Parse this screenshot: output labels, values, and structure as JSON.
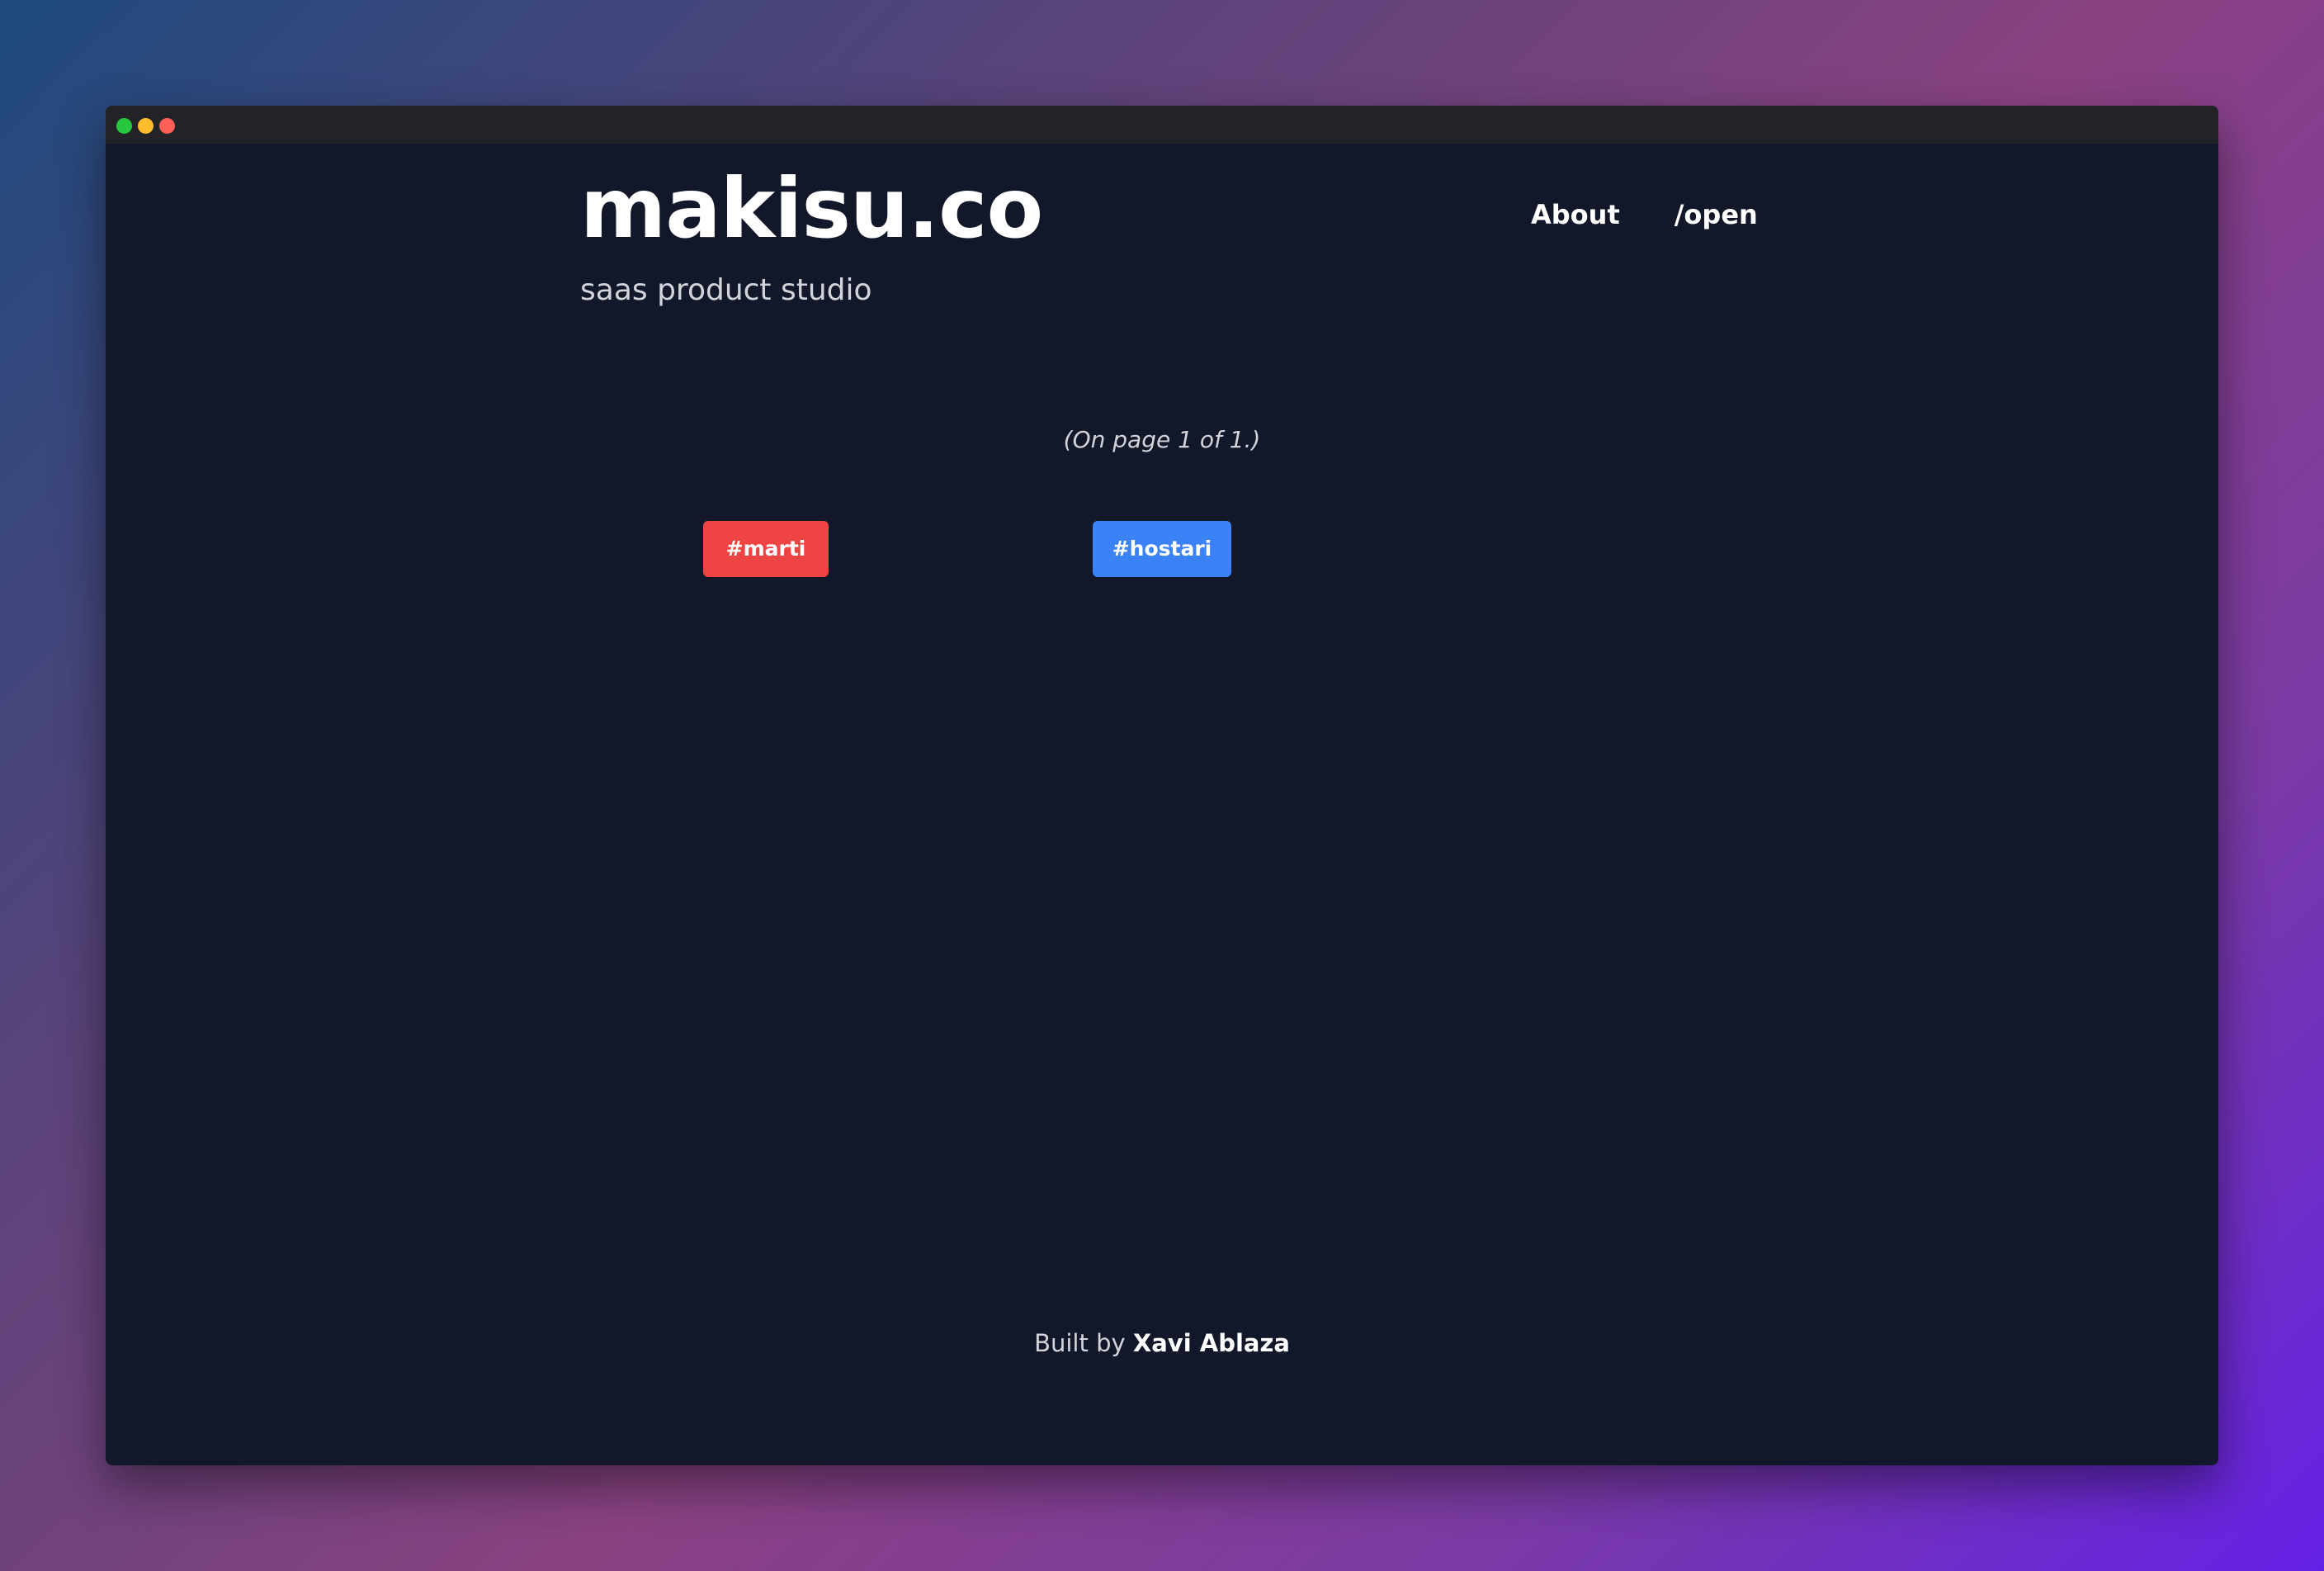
{
  "window": {
    "controls": [
      "green-dot",
      "yellow-dot",
      "red-dot"
    ]
  },
  "header": {
    "title": "makisu.co",
    "tagline": "saas product studio",
    "nav": [
      {
        "label": "About"
      },
      {
        "label": "/open"
      }
    ]
  },
  "main": {
    "page_indicator": "(On page 1 of 1.)",
    "tags": [
      {
        "label": "#marti",
        "color": "#ef4444"
      },
      {
        "label": "#hostari",
        "color": "#3b82f6"
      }
    ]
  },
  "footer": {
    "prefix": "Built by",
    "author": "Xavi Ablaza"
  },
  "colors": {
    "page_bg": "#121829",
    "titlebar_bg": "#222326",
    "text_primary": "#ffffff",
    "text_muted": "#d1d5db"
  }
}
